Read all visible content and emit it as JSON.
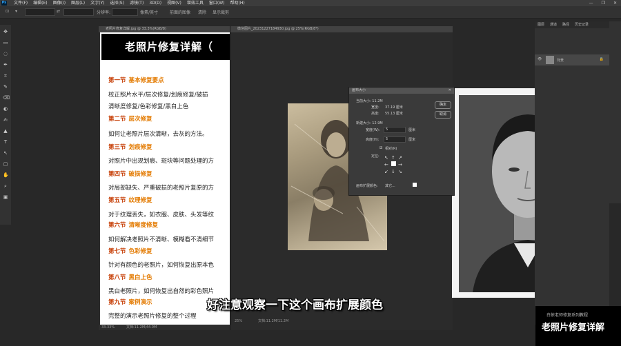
{
  "menubar": {
    "app_icon": "Ps",
    "items": [
      "文件(F)",
      "编辑(E)",
      "图像(I)",
      "图层(L)",
      "文字(Y)",
      "选择(S)",
      "滤镜(T)",
      "3D(D)",
      "视图(V)",
      "增效工具",
      "窗口(W)",
      "帮助(H)"
    ]
  },
  "optionsbar": {
    "width_label": "宽度:",
    "height_label": "高:",
    "res_label": "分辨率:",
    "unit": "像素/英寸",
    "front_image": "前面的图像",
    "clear": "清除",
    "show_resize": "显示裁剪"
  },
  "doc1": {
    "tab": "老照片修复详解.jpg @ 33.3%(RGB/8)",
    "title": "老照片修复详解（",
    "sections": [
      {
        "num": "第一节",
        "name": "基本修复要点",
        "desc": "校正照片水平/层次修复/划痕修复/破损"
      },
      {
        "num": "",
        "name": "",
        "desc": "清晰度修复/色彩修复/黑白上色"
      },
      {
        "num": "第二节",
        "name": "层次修复",
        "desc": "如何让老照片层次清晰，去灰的方法。"
      },
      {
        "num": "第三节",
        "name": "划痕修复",
        "desc": "对照片中出现划痕、斑块等问题处理的方"
      },
      {
        "num": "第四节",
        "name": "破损修复",
        "desc": "对局部缺失、严重破损的老照片复原的方"
      },
      {
        "num": "第五节",
        "name": "纹理修复",
        "desc": "对于纹理丢失，如衣服、皮肤、头发等纹"
      },
      {
        "num": "第六节",
        "name": "清晰度修复",
        "desc": "如何解决老照片不清晰、模糊看不清细节"
      },
      {
        "num": "第七节",
        "name": "色彩修复",
        "desc": "针对有颜色的老照片，如何恢复出原本色"
      },
      {
        "num": "第八节",
        "name": "黑白上色",
        "desc": "黑白老照片，如何恢复出自然的彩色照片"
      },
      {
        "num": "第九节",
        "name": "案例演示",
        "desc": "完整的演示老照片修复的整个过程"
      }
    ],
    "zoom": "33.33%",
    "doc_size": "文档:11.2M/44.0M"
  },
  "doc2": {
    "tab": "微信图片_20231227184930.jpg @ 25%(RGB/8*)",
    "zoom": "25%",
    "doc_size": "文档:11.2M/11.2M"
  },
  "dialog": {
    "title": "画布大小",
    "current_size_label": "当前大小: 11.2M",
    "width_label": "宽度:",
    "width_value": "37.19 厘米",
    "height_label": "高度:",
    "height_value": "55.13 厘米",
    "new_size_label": "新建大小: 12.9M",
    "new_width_label": "宽度(W):",
    "new_width_value": "5",
    "new_height_label": "高度(H):",
    "new_height_value": "5",
    "unit": "厘米",
    "relative_label": "相对(R)",
    "anchor_label": "定位:",
    "ok": "确定",
    "cancel": "取消",
    "ext_color_label": "画布扩展颜色:",
    "ext_color_value": "其它..."
  },
  "panel": {
    "tabs": [
      "图层",
      "通道",
      "路径",
      "历史记录"
    ],
    "layer_name": "背景"
  },
  "subtitle": "好注意观察一下这个画布扩展颜色",
  "brand": {
    "small": "白依老师修复系列教程",
    "big": "老照片修复详解"
  },
  "colors": {
    "accent": "#31a8ff",
    "section_num": "#c53a00",
    "section_name": "#e37a00"
  }
}
